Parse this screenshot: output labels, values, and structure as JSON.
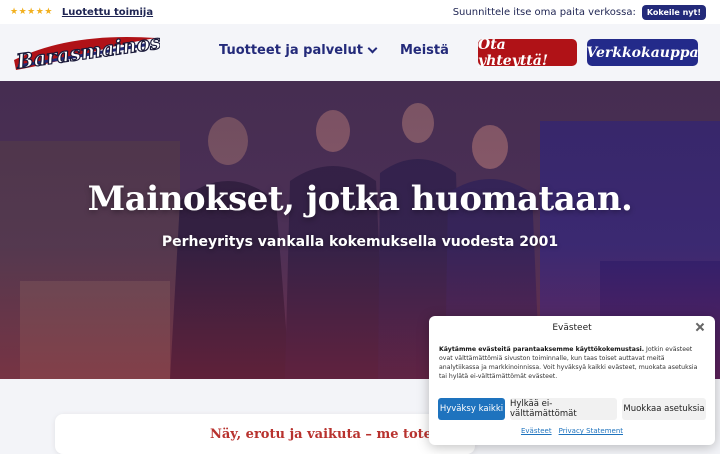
{
  "topbar": {
    "rating_stars": 5,
    "trusted_label": "Luotettu toimija",
    "design_text": "Suunnittele itse oma paita verkossa:",
    "try_button": "Kokeile nyt!"
  },
  "header": {
    "logo_text": "Barasmainos",
    "nav": [
      {
        "label": "Tuotteet ja palvelut",
        "has_dropdown": true
      },
      {
        "label": "Meistä",
        "has_dropdown": false
      }
    ],
    "contact_button": "Ota yhteyttä!",
    "shop_button": "Verkkokauppa"
  },
  "hero": {
    "title": "Mainokset, jotka huomataan.",
    "subtitle": "Perheyritys vankalla kokemuksella vuodesta 2001"
  },
  "section": {
    "title": "Näy, erotu ja vaikuta – me toteuta"
  },
  "cookie_banner": {
    "title": "Evästeet",
    "text_bold": "Käytämme evästeitä parantaaksemme käyttökokemustasi.",
    "text_rest": " Jotkin evästeet ovat välttämättömiä sivuston toiminnalle, kun taas toiset auttavat meitä analytiikassa ja markkinoinnissa. Voit hyväksyä kaikki evästeet, muokata asetuksia tai hylätä ei-välttämättömät evästeet.",
    "accept_label": "Hyväksy kaikki",
    "deny_label": "Hylkää ei-välttämättömät",
    "prefs_label": "Muokkaa asetuksia",
    "links": [
      "Evästeet",
      "Privacy Statement"
    ]
  },
  "colors": {
    "brand_blue": "#232a7a",
    "brand_red": "#b01217",
    "accent_blue": "#1e73be",
    "star": "#f2b01e"
  }
}
